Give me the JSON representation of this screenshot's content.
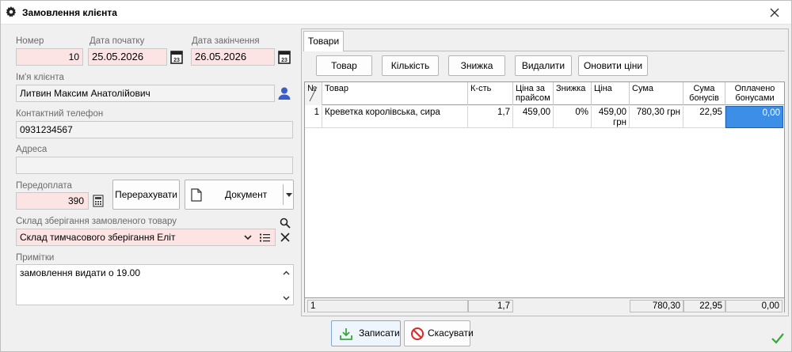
{
  "window": {
    "title": "Замовлення клієнта"
  },
  "form": {
    "number_label": "Номер",
    "number_value": "10",
    "start_date_label": "Дата початку",
    "start_date_value": "25.05.2026",
    "end_date_label": "Дата закінчення",
    "end_date_value": "26.05.2026",
    "calendar_icon_text": "23",
    "client_label": "Ім'я клієнта",
    "client_value": "Литвин Максим Анатолійович",
    "phone_label": "Контактний телефон",
    "phone_value": "0931234567",
    "address_label": "Адреса",
    "address_value": "",
    "prepay_label": "Передоплата",
    "prepay_value": "390",
    "recalc_button": "Перерахувати",
    "document_button": "Документ",
    "warehouse_label": "Склад зберігання замовленого товару",
    "warehouse_value": "Склад тимчасового зберігання Еліт",
    "notes_label": "Примітки",
    "notes_value": "замовлення видати о 19.00"
  },
  "tabs": [
    {
      "label": "Товари"
    }
  ],
  "toolbar": {
    "product": "Товар",
    "quantity": "Кількість",
    "discount": "Знижка",
    "delete": "Видалити",
    "update_prices": "Оновити ціни"
  },
  "table": {
    "corner": "№",
    "columns": [
      "Товар",
      "К-сть",
      "Ціна за прайсом",
      "Знижка",
      "Ціна",
      "Сума",
      "Сума бонусів",
      "Оплачено бонусами"
    ],
    "rows": [
      {
        "n": "1",
        "product": "Креветка королівська, сира",
        "qty": "1,7",
        "price_list": "459,00",
        "discount": "0%",
        "price": "459,00 грн",
        "sum": "780,30 грн",
        "bonus_sum": "22,95",
        "paid_bonus": "0,00"
      }
    ],
    "footer": {
      "count": "1",
      "qty": "1,7",
      "sum": "780,30",
      "bonus_sum": "22,95",
      "paid_bonus": "0,00"
    }
  },
  "actions": {
    "save": "Записати",
    "cancel": "Скасувати"
  },
  "icons": {
    "gear": "gear-icon",
    "close": "close-icon",
    "calendar": "calendar-icon",
    "person": "person-icon",
    "calculator": "calculator-icon",
    "document": "document-icon",
    "search": "search-icon",
    "list": "list-icon",
    "clear": "clear-icon",
    "save": "download-icon",
    "cancel": "forbidden-icon",
    "check": "checkmark-icon"
  },
  "colors": {
    "required_field": "#fde4e4",
    "selection": "#3c8ee6",
    "person_icon": "#3b5dc6",
    "save_icon": "#38a83a",
    "cancel_icon": "#d62a2a"
  }
}
